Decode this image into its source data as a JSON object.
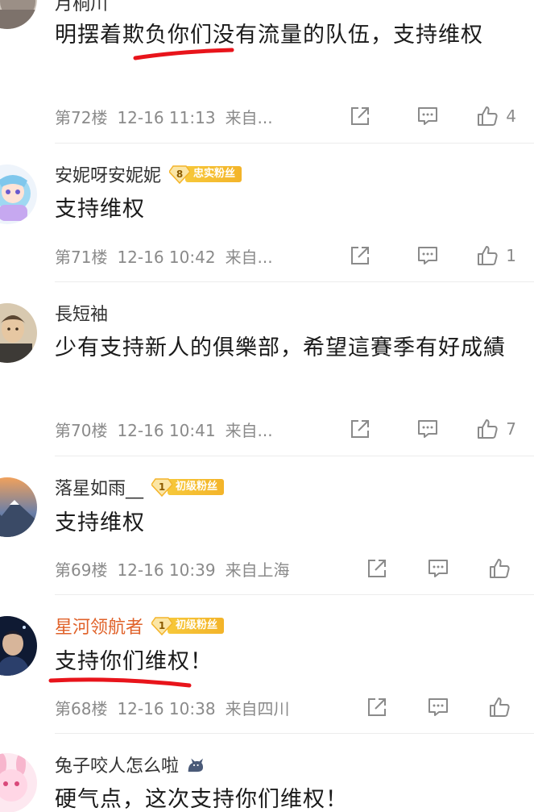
{
  "comments": [
    {
      "user": "月桐川",
      "text": "明摆着欺负你们没有流量的队伍，支持维权",
      "floor": "第72楼",
      "time": "12-16 11:13",
      "location": "来自...",
      "likes": "4"
    },
    {
      "user": "安妮呀安妮妮",
      "badge_level": "8",
      "badge_label": "忠实粉丝",
      "text": "支持维权",
      "floor": "第71楼",
      "time": "12-16 10:42",
      "location": "来自...",
      "likes": "1"
    },
    {
      "user": "長短袖",
      "text": "少有支持新人的俱樂部，希望這賽季有好成績",
      "floor": "第70楼",
      "time": "12-16 10:41",
      "location": "来自...",
      "likes": "7"
    },
    {
      "user": "落星如雨__",
      "badge_level": "1",
      "badge_label": "初级粉丝",
      "text": "支持维权",
      "floor": "第69楼",
      "time": "12-16 10:39",
      "location": "来自上海",
      "likes": ""
    },
    {
      "user": "星河领航者",
      "badge_level": "1",
      "badge_label": "初级粉丝",
      "text": "支持你们维权！",
      "floor": "第68楼",
      "time": "12-16 10:38",
      "location": "来自四川",
      "likes": ""
    },
    {
      "user": "兔子咬人怎么啦",
      "text": "硬气点，这次支持你们维权！"
    }
  ],
  "colors": {
    "highlight_username": "#e0622a",
    "badge_gold": "#f3b42a",
    "annotation_red": "#e8141b"
  }
}
